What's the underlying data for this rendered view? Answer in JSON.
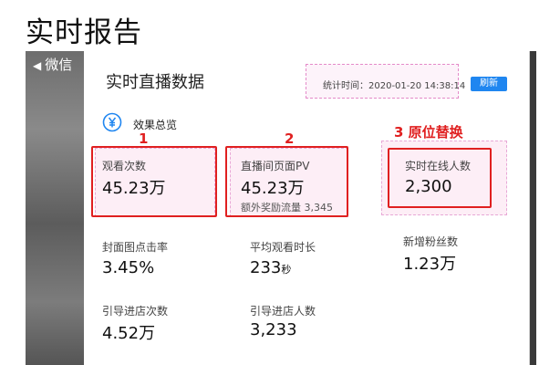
{
  "page_title": "实时报告",
  "back_button": {
    "label": "微信"
  },
  "panel": {
    "title": "实时直播数据",
    "stat_time": "统计时间：2020-01-20 14:38:14",
    "refresh_label": "刷新",
    "section_label": "效果总览"
  },
  "annotations": {
    "n1": "1",
    "n2": "2",
    "n3": "3 原位替换"
  },
  "metrics": [
    {
      "label": "观看次数",
      "value": "45.23万"
    },
    {
      "label": "直播间页面PV",
      "value": "45.23万",
      "sub": "额外奖励流量 3,345"
    },
    {
      "label": "实时在线人数",
      "value": "2,300"
    },
    {
      "label": "封面图点击率",
      "value": "3.45%"
    },
    {
      "label": "平均观看时长",
      "value": "233",
      "unit": "秒"
    },
    {
      "label": "新增粉丝数",
      "value": "1.23万"
    },
    {
      "label": "引导进店次数",
      "value": "4.52万"
    },
    {
      "label": "引导进店人数",
      "value": "3,233"
    }
  ],
  "colors": {
    "highlight_red": "#e02020",
    "highlight_pink": "#fdeef6",
    "refresh_blue": "#1f86f0"
  }
}
